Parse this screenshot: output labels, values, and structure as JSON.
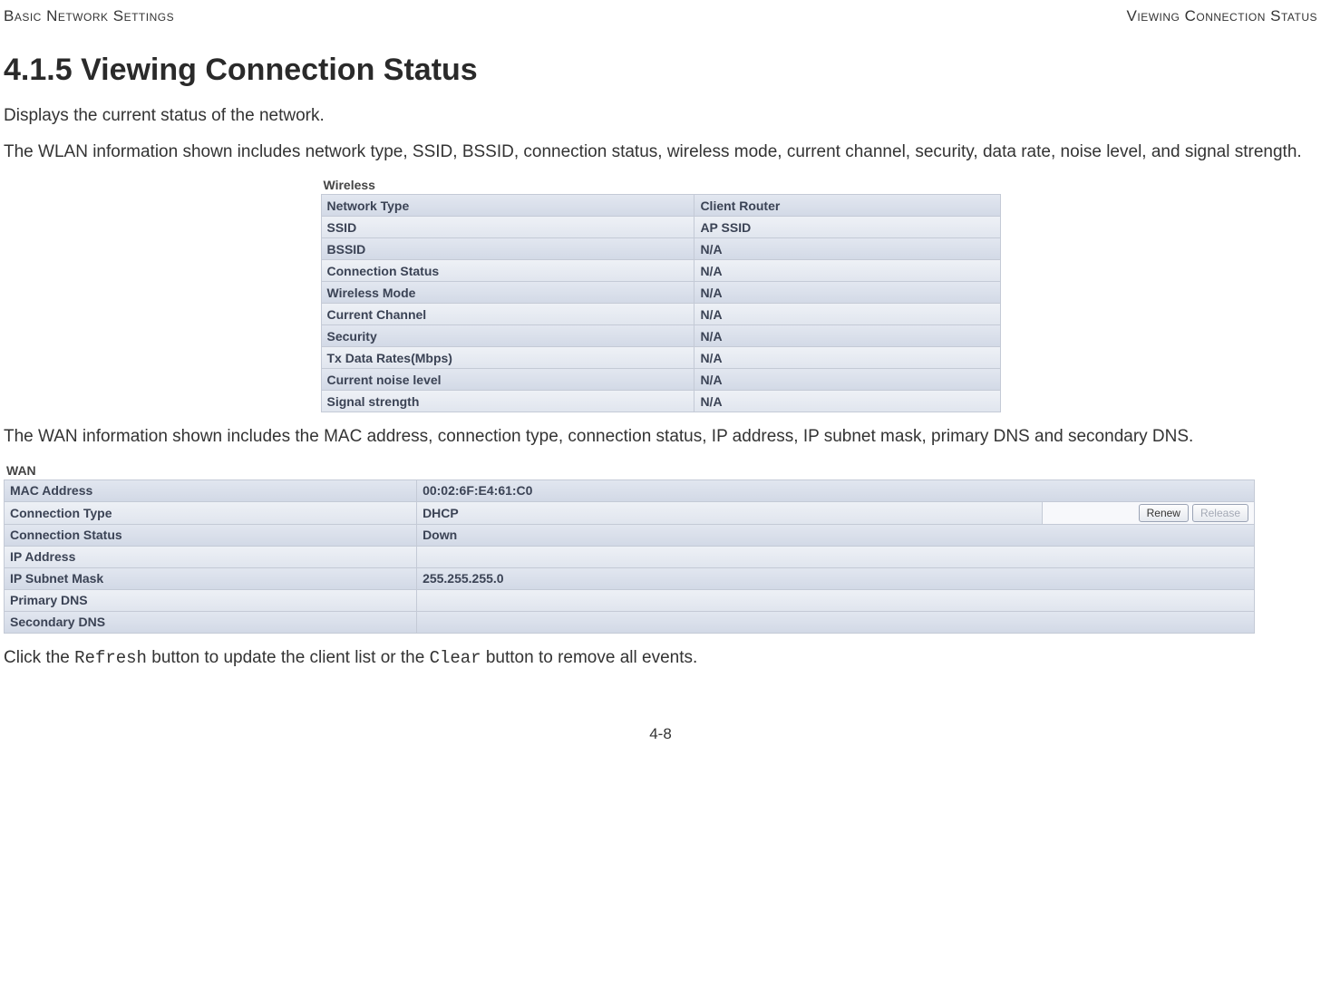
{
  "header": {
    "left": "Basic Network Settings",
    "right": "Viewing Connection Status"
  },
  "title": "4.1.5 Viewing Connection Status",
  "p1": "Displays the current status of the network.",
  "p2": "The WLAN information shown includes network type, SSID, BSSID, connection status, wireless mode, current channel, security, data rate, noise level, and signal strength.",
  "wireless": {
    "caption": "Wireless",
    "rows": [
      {
        "label": "Network Type",
        "value": "Client Router"
      },
      {
        "label": "SSID",
        "value": "AP SSID"
      },
      {
        "label": "BSSID",
        "value": "N/A"
      },
      {
        "label": "Connection Status",
        "value": "N/A"
      },
      {
        "label": "Wireless Mode",
        "value": "N/A"
      },
      {
        "label": "Current Channel",
        "value": "N/A"
      },
      {
        "label": "Security",
        "value": "N/A"
      },
      {
        "label": "Tx Data Rates(Mbps)",
        "value": "N/A"
      },
      {
        "label": "Current noise level",
        "value": "N/A"
      },
      {
        "label": "Signal strength",
        "value": "N/A"
      }
    ]
  },
  "p3": "The WAN information shown includes the MAC address, connection type, connection status, IP address, IP subnet mask, primary DNS and secondary DNS.",
  "wan": {
    "caption": "WAN",
    "rows": [
      {
        "label": "MAC Address",
        "value": "00:02:6F:E4:61:C0",
        "buttons": false
      },
      {
        "label": "Connection Type",
        "value": "DHCP",
        "buttons": true,
        "btn1": "Renew",
        "btn2": "Release"
      },
      {
        "label": "Connection Status",
        "value": "Down",
        "buttons": false
      },
      {
        "label": "IP Address",
        "value": "",
        "buttons": false
      },
      {
        "label": "IP Subnet Mask",
        "value": "255.255.255.0",
        "buttons": false
      },
      {
        "label": "Primary DNS",
        "value": "",
        "buttons": false
      },
      {
        "label": "Secondary DNS",
        "value": "",
        "buttons": false
      }
    ]
  },
  "p4a": "Click the ",
  "p4b": "Refresh",
  "p4c": " button to update the client list or the ",
  "p4d": "Clear",
  "p4e": " button to remove all events.",
  "pagenum": "4-8"
}
